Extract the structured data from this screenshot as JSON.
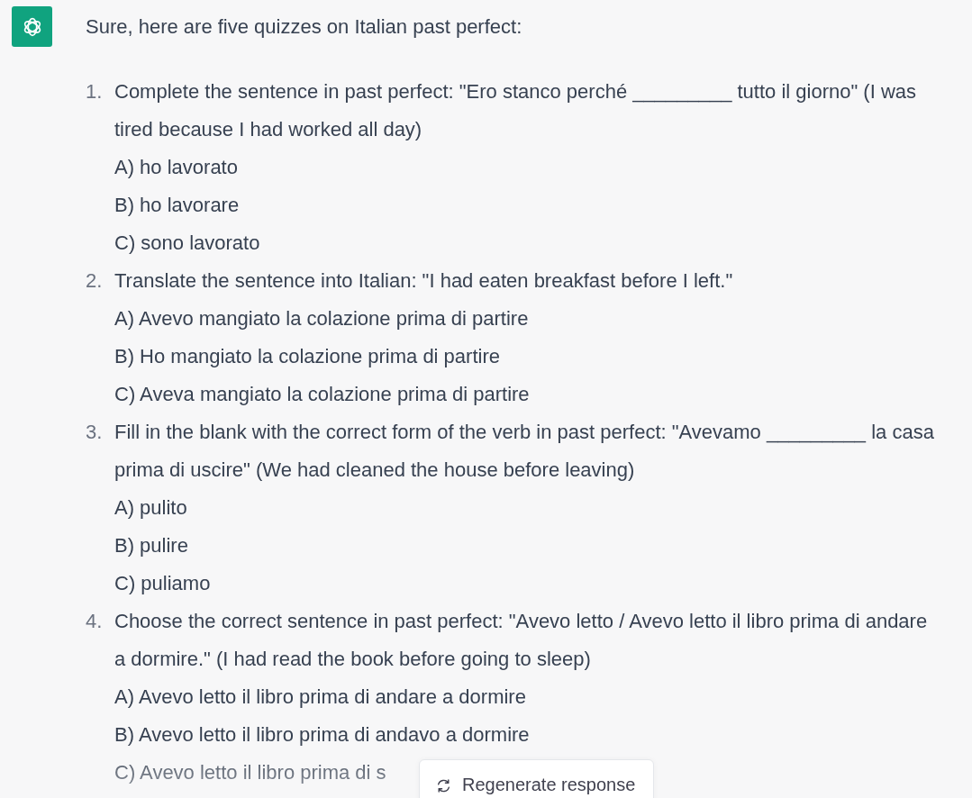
{
  "message": {
    "intro": "Sure, here are five quizzes on Italian past perfect:",
    "items": [
      {
        "number": "1.",
        "question": "Complete the sentence in past perfect: \"Ero stanco perché _________ tutto il giorno\" (I was tired because I had worked all day)",
        "options": [
          "A) ho lavorato",
          "B) ho lavorare",
          "C) sono lavorato"
        ]
      },
      {
        "number": "2.",
        "question": "Translate the sentence into Italian: \"I had eaten breakfast before I left.\"",
        "options": [
          "A) Avevo mangiato la colazione prima di partire",
          "B) Ho mangiato la colazione prima di partire",
          "C) Aveva mangiato la colazione prima di partire"
        ]
      },
      {
        "number": "3.",
        "question": "Fill in the blank with the correct form of the verb in past perfect: \"Avevamo _________ la casa prima di uscire\" (We had cleaned the house before leaving)",
        "options": [
          "A) pulito",
          "B) pulire",
          "C) puliamo"
        ]
      },
      {
        "number": "4.",
        "question": "Choose the correct sentence in past perfect: \"Avevo letto / Avevo letto il libro prima di andare a dormire.\" (I had read the book before going to sleep)",
        "options": [
          "A) Avevo letto il libro prima di andare a dormire",
          "B) Avevo letto il libro prima di andavo a dormire",
          "C) Avevo letto il libro prima di s"
        ]
      }
    ]
  },
  "regenerate_button": {
    "label": "Regenerate response"
  }
}
